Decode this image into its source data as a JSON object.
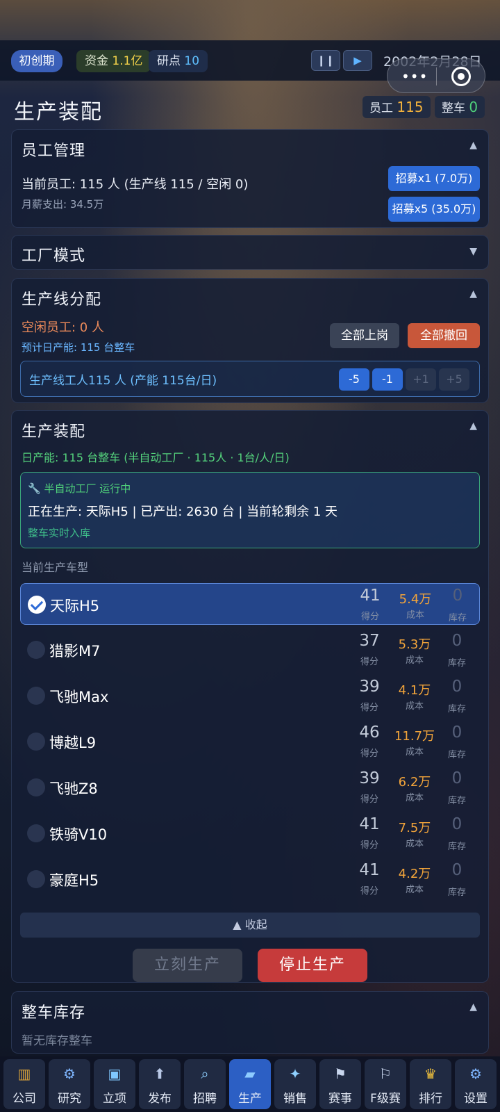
{
  "topbar": {
    "stage": "初创期",
    "fund_label": "资金",
    "fund_value": "1.1亿",
    "research_label": "研点",
    "research_value": "10",
    "pause_icon": "pause-icon",
    "play_icon": "play-icon",
    "date": "2002年2月28日",
    "capsule_dots": "•••"
  },
  "header": {
    "title": "生产装配",
    "employee_label": "员工",
    "employee_value": "115",
    "car_label": "整车",
    "car_value": "0"
  },
  "staff": {
    "title": "员工管理",
    "current": "当前员工: 115 人 (生产线 115 / 空闲 0)",
    "salary": "月薪支出: 34.5万",
    "hire1": "招募x1 (7.0万)",
    "hire5": "招募x5 (35.0万)"
  },
  "factory_mode": {
    "title": "工厂模式"
  },
  "line_assign": {
    "title": "生产线分配",
    "idle": "空闲员工: 0 人",
    "forecast": "预计日产能: 115 台整车",
    "all_on": "全部上岗",
    "all_off": "全部撤回",
    "line_workers": "生产线工人115 人 (产能 115台/日)",
    "steps": [
      "-5",
      "-1",
      "+1",
      "+5"
    ]
  },
  "assembly": {
    "title": "生产装配",
    "capacity": "日产能: 115 台整车 (半自动工厂 · 115人 · 1台/人/日)",
    "status_title": "半自动工厂 运行中",
    "status_main": "正在生产: 天际H5 | 已产出: 2630 台 | 当前轮剩余 1 天",
    "status_sub": "整车实时入库",
    "models_label": "当前生产车型",
    "score_label": "得分",
    "cost_label": "成本",
    "stock_label": "库存",
    "cars": [
      {
        "name": "天际H5",
        "score": "41",
        "cost": "5.4万",
        "stock": "0",
        "selected": true
      },
      {
        "name": "猎影M7",
        "score": "37",
        "cost": "5.3万",
        "stock": "0",
        "selected": false
      },
      {
        "name": "飞驰Max",
        "score": "39",
        "cost": "4.1万",
        "stock": "0",
        "selected": false
      },
      {
        "name": "博越L9",
        "score": "46",
        "cost": "11.7万",
        "stock": "0",
        "selected": false
      },
      {
        "name": "飞驰Z8",
        "score": "39",
        "cost": "6.2万",
        "stock": "0",
        "selected": false
      },
      {
        "name": "铁骑V10",
        "score": "41",
        "cost": "7.5万",
        "stock": "0",
        "selected": false
      },
      {
        "name": "豪庭H5",
        "score": "41",
        "cost": "4.2万",
        "stock": "0",
        "selected": false
      }
    ],
    "collapse": "▲ 收起",
    "produce_now": "立刻生产",
    "stop": "停止生产"
  },
  "inventory": {
    "title": "整车库存",
    "empty": "暂无库存整车"
  },
  "nav": [
    {
      "label": "公司",
      "icon": "building-icon",
      "glyph": "▥",
      "color": "#d9a23a"
    },
    {
      "label": "研究",
      "icon": "research-icon",
      "glyph": "⚙",
      "color": "#7fb6ff"
    },
    {
      "label": "立项",
      "icon": "project-icon",
      "glyph": "▣",
      "color": "#7fc8ff"
    },
    {
      "label": "发布",
      "icon": "launch-icon",
      "glyph": "⬆",
      "color": "#b9c8e6"
    },
    {
      "label": "招聘",
      "icon": "recruit-icon",
      "glyph": "⌕",
      "color": "#8fd0ff"
    },
    {
      "label": "生产",
      "icon": "car-icon",
      "glyph": "▰",
      "color": "#8ecbff",
      "active": true
    },
    {
      "label": "销售",
      "icon": "sales-icon",
      "glyph": "✦",
      "color": "#8fd0ff"
    },
    {
      "label": "赛事",
      "icon": "race-icon",
      "glyph": "⚑",
      "color": "#c9d6ee"
    },
    {
      "label": "F级赛",
      "icon": "formula-icon",
      "glyph": "⚐",
      "color": "#c9d6ee"
    },
    {
      "label": "排行",
      "icon": "trophy-icon",
      "glyph": "♛",
      "color": "#f2c23c"
    },
    {
      "label": "设置",
      "icon": "settings-icon",
      "glyph": "⚙",
      "color": "#7fb6ff"
    }
  ]
}
